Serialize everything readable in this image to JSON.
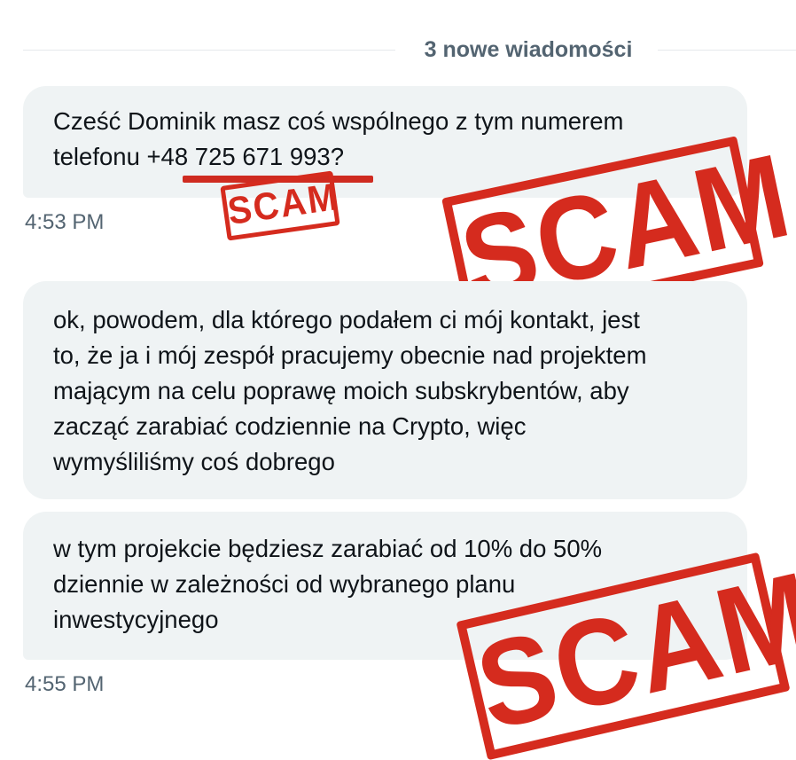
{
  "divider": {
    "label": "3 nowe wiadomości"
  },
  "messages": [
    {
      "lines": [
        "Cześć Dominik masz coś wspólnego z tym numerem",
        "telefonu +48 725 671 993?"
      ],
      "time": "4:53 PM"
    },
    {
      "lines": [
        "ok, powodem, dla którego podałem ci mój kontakt, jest",
        "to, że ja i mój zespół pracujemy obecnie nad projektem",
        "mającym na celu poprawę moich subskrybentów, aby",
        "zacząć zarabiać codziennie na Crypto, więc",
        "wymyśliliśmy coś dobrego"
      ]
    },
    {
      "lines": [
        "w tym projekcie będziesz zarabiać od 10% do 50%",
        "dziennie w zależności od wybranego planu",
        "inwestycyjnego"
      ],
      "time": "4:55 PM"
    }
  ],
  "stamps": {
    "small": "SCAM",
    "large_top": "SCAM",
    "large_bottom": "SCAM"
  },
  "colors": {
    "stamp": "#d52b1e",
    "bubble": "#eff3f4",
    "muted_text": "#536471"
  }
}
